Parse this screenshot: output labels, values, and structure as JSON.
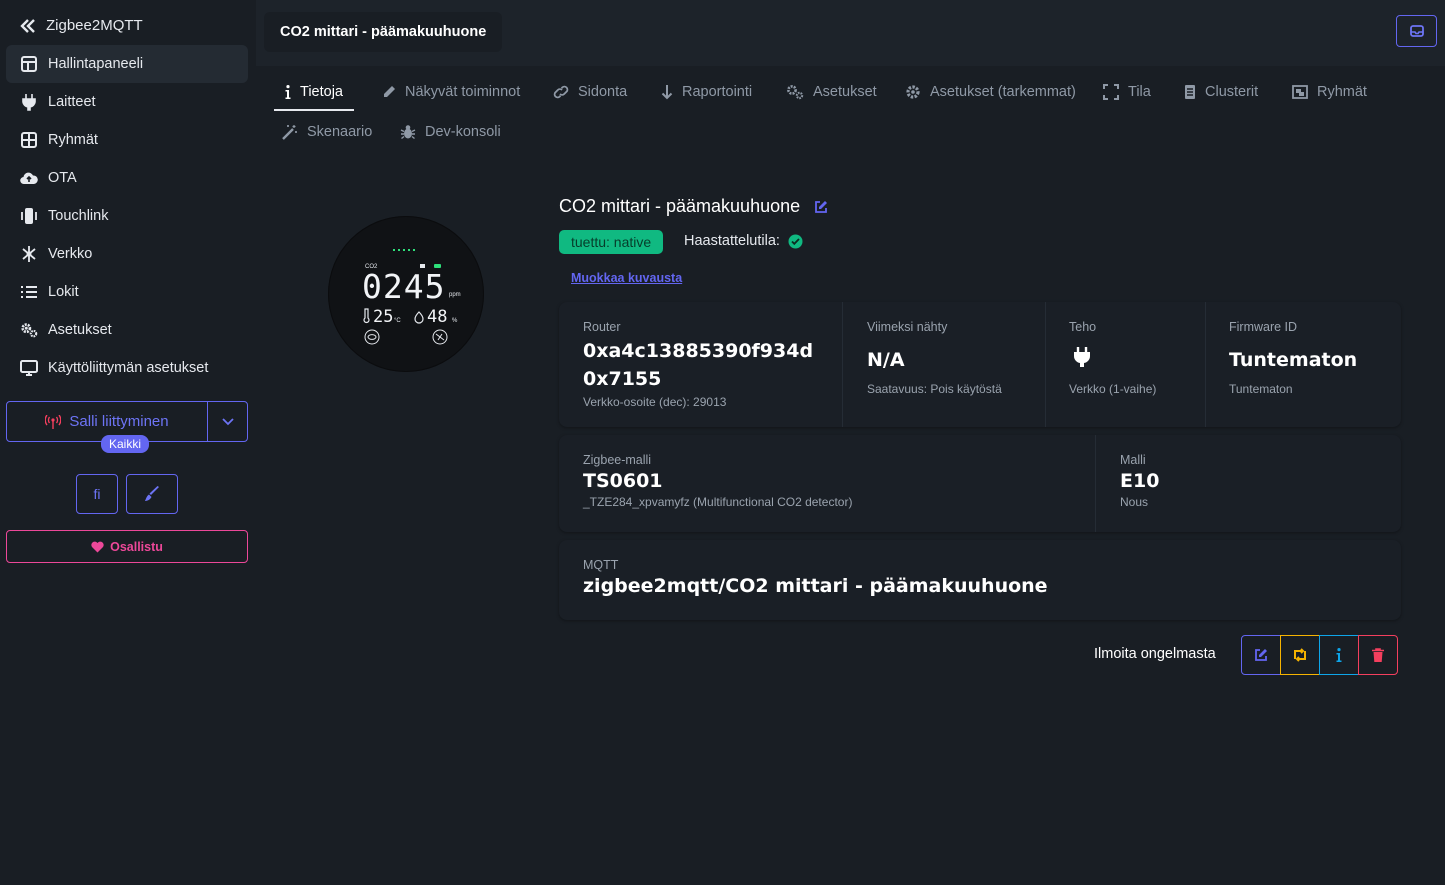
{
  "sidebar": {
    "brand": "Zigbee2MQTT",
    "items": [
      {
        "label": "Hallintapaneeli",
        "icon": "dashboard-icon",
        "active": true
      },
      {
        "label": "Laitteet",
        "icon": "plug-icon"
      },
      {
        "label": "Ryhmät",
        "icon": "grid-icon"
      },
      {
        "label": "OTA",
        "icon": "cloud-upload-icon"
      },
      {
        "label": "Touchlink",
        "icon": "touchlink-icon"
      },
      {
        "label": "Verkko",
        "icon": "network-icon"
      },
      {
        "label": "Lokit",
        "icon": "list-icon"
      },
      {
        "label": "Asetukset",
        "icon": "cogs-icon"
      },
      {
        "label": "Käyttöliittymän asetukset",
        "icon": "monitor-icon"
      }
    ],
    "permit_join": "Salli liittyminen",
    "permit_badge": "Kaikki",
    "language_button": "fi",
    "sponsor_button": "Osallistu"
  },
  "header": {
    "title": "CO2 mittari - päämakuuhuone"
  },
  "tabs": [
    {
      "label": "Tietoja",
      "icon": "info-icon",
      "active": true
    },
    {
      "label": "Näkyvät toiminnot",
      "icon": "pencil-icon"
    },
    {
      "label": "Sidonta",
      "icon": "link-icon"
    },
    {
      "label": "Raportointi",
      "icon": "arrow-down-icon"
    },
    {
      "label": "Asetukset",
      "icon": "cogs-icon"
    },
    {
      "label": "Asetukset (tarkemmat)",
      "icon": "cog-icon"
    },
    {
      "label": "Tila",
      "icon": "expand-icon"
    },
    {
      "label": "Clusterit",
      "icon": "document-icon"
    },
    {
      "label": "Ryhmät",
      "icon": "object-group-icon"
    },
    {
      "label": "Skenaario",
      "icon": "magic-wand-icon"
    },
    {
      "label": "Dev-konsoli",
      "icon": "bug-icon"
    }
  ],
  "device": {
    "name": "CO2 mittari - päämakuuhuone",
    "support_badge": "tuettu: native",
    "interview_label": "Haastattelutila:",
    "edit_description": "Muokkaa kuvausta",
    "display": {
      "co2": "0245",
      "temp": "25",
      "humidity": "48",
      "co2_label": "CO2",
      "ppm_label": "ppm",
      "temp_unit": "°C",
      "humidity_unit": "%"
    },
    "stats": {
      "router": {
        "label": "Router",
        "value1": "0xa4c13885390f934d",
        "value2": "0x7155",
        "sub": "Verkko-osoite (dec): 29013"
      },
      "last_seen": {
        "label": "Viimeksi nähty",
        "value": "N/A",
        "sub": "Saatavuus: Pois käytöstä"
      },
      "power": {
        "label": "Teho",
        "sub": "Verkko (1-vaihe)"
      },
      "firmware": {
        "label": "Firmware ID",
        "value": "Tuntematon",
        "sub": "Tuntematon"
      },
      "zigbee_model": {
        "label": "Zigbee-malli",
        "value": "TS0601",
        "sub": "_TZE284_xpvamyfz (Multifunctional CO2 detector)"
      },
      "model": {
        "label": "Malli",
        "value": "E10",
        "sub": "Nous"
      },
      "mqtt": {
        "label": "MQTT",
        "value": "zigbee2mqtt/CO2 mittari - päämakuuhuone"
      }
    },
    "report_issue": "Ilmoita ongelmasta"
  },
  "colors": {
    "accent": "#6366f1",
    "success": "#10b981",
    "warning": "#f5b301",
    "info": "#0ea5e9",
    "danger": "#f43f5e",
    "sponsor": "#ec4899"
  }
}
